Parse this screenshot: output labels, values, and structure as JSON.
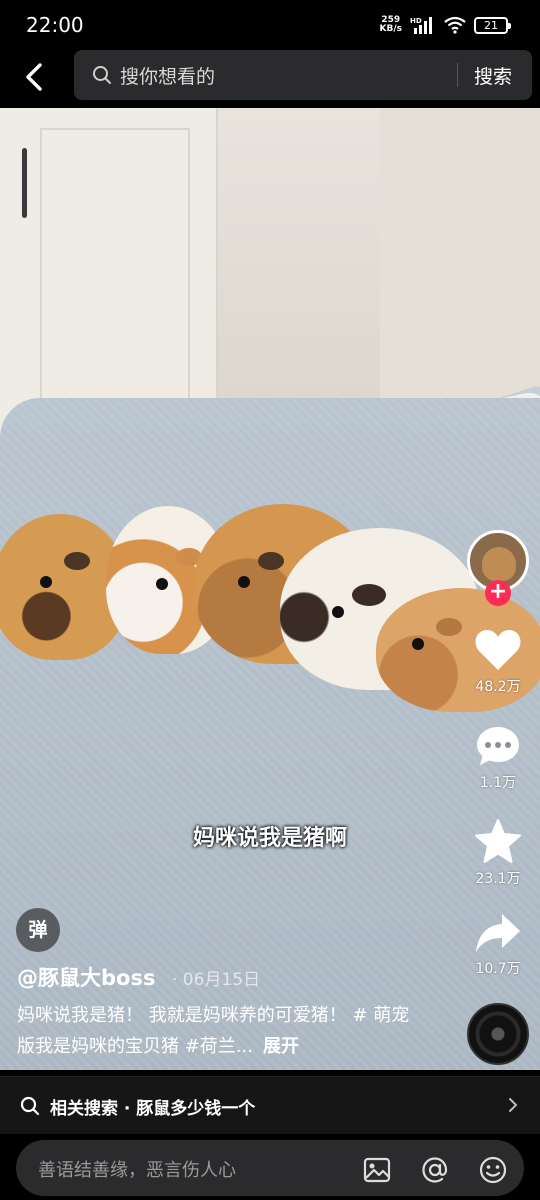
{
  "status_bar": {
    "time": "22:00",
    "net_speed_value": "259",
    "net_speed_unit": "KB/s",
    "hd_label": "HD",
    "battery": "21"
  },
  "search": {
    "placeholder": "搜你想看的",
    "submit_label": "搜索"
  },
  "video": {
    "subtitle": "妈咪说我是猪啊"
  },
  "right_rail": {
    "likes": "48.2万",
    "comments": "1.1万",
    "favorites": "23.1万",
    "shares": "10.7万",
    "follow_symbol": "+"
  },
  "danmaku_label": "弹",
  "post": {
    "author": "@豚鼠大boss",
    "date": "· 06月15日",
    "caption": "妈咪说我是猪！ 我就是妈咪养的可爱猪！ # 萌宠版我是妈咪的宝贝猪 #荷兰...",
    "expand_label": "展开"
  },
  "related_search": {
    "text": "相关搜索 · 豚鼠多少钱一个"
  },
  "comment_bar": {
    "placeholder": "善语结善缘，恶言伤人心"
  },
  "icons": [
    "back-icon",
    "search-icon",
    "heart-icon",
    "comment-icon",
    "star-icon",
    "share-icon",
    "image-icon",
    "at-icon",
    "emoji-icon",
    "chevron-right-icon"
  ],
  "colors": {
    "accent": "#fe2c55",
    "input_bg": "#2b2b2d"
  }
}
